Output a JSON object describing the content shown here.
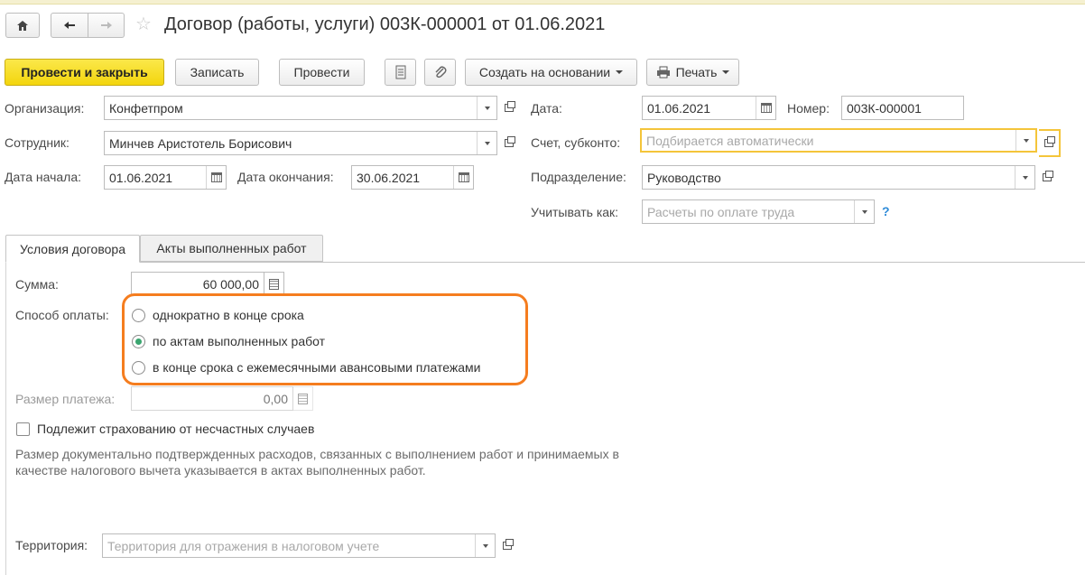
{
  "window": {
    "title": "Договор (работы, услуги) 003К-000001 от 01.06.2021",
    "nav": {
      "home_icon": "home-icon",
      "back_icon": "arrow-left-icon",
      "forward_icon": "arrow-right-icon",
      "favorite_icon": "star-icon"
    }
  },
  "toolbar": {
    "post_close_label": "Провести и закрыть",
    "save_label": "Записать",
    "post_label": "Провести",
    "report_icon": "report-icon",
    "attach_icon": "paperclip-icon",
    "create_based_label": "Создать на основании",
    "print_label": "Печать",
    "print_icon": "printer-icon"
  },
  "form": {
    "organization": {
      "label": "Организация:",
      "value": "Конфетпром"
    },
    "employee": {
      "label": "Сотрудник:",
      "value": "Минчев Аристотель Борисович"
    },
    "start_date": {
      "label": "Дата начала:",
      "value": "01.06.2021"
    },
    "end_date": {
      "label": "Дата окончания:",
      "value": "30.06.2021"
    },
    "date": {
      "label": "Дата:",
      "value": "01.06.2021"
    },
    "number": {
      "label": "Номер:",
      "value": "003К-000001"
    },
    "account": {
      "label": "Счет, субконто:",
      "placeholder": "Подбирается автоматически"
    },
    "department": {
      "label": "Подразделение:",
      "value": "Руководство"
    },
    "account_as": {
      "label": "Учитывать как:",
      "placeholder": "Расчеты по оплате труда",
      "help": "?"
    }
  },
  "tabs": [
    {
      "label": "Условия договора",
      "active": true
    },
    {
      "label": "Акты выполненных работ",
      "active": false
    }
  ],
  "conditions": {
    "sum": {
      "label": "Сумма:",
      "value": "60 000,00"
    },
    "payment_method": {
      "label": "Способ оплаты:",
      "options": [
        {
          "label": "однократно в конце срока",
          "selected": false
        },
        {
          "label": "по актам выполненных работ",
          "selected": true
        },
        {
          "label": "в конце срока с ежемесячными авансовыми платежами",
          "selected": false
        }
      ]
    },
    "payment_size": {
      "label": "Размер платежа:",
      "value": "0,00"
    },
    "insurance": {
      "label": "Подлежит страхованию от несчастных случаев",
      "checked": false
    },
    "note_line1": "Размер документально подтвержденных расходов, связанных с выполнением работ и принимаемых в",
    "note_line2": "качестве налогового вычета указывается в актах выполненных работ.",
    "territory": {
      "label": "Территория:",
      "placeholder": "Территория для отражения в налоговом учете"
    }
  },
  "colors": {
    "primary_button": "#f5d81a",
    "highlight": "#f57d1f",
    "focus_border": "#f4c53a",
    "radio_selected": "#3aa56f"
  }
}
